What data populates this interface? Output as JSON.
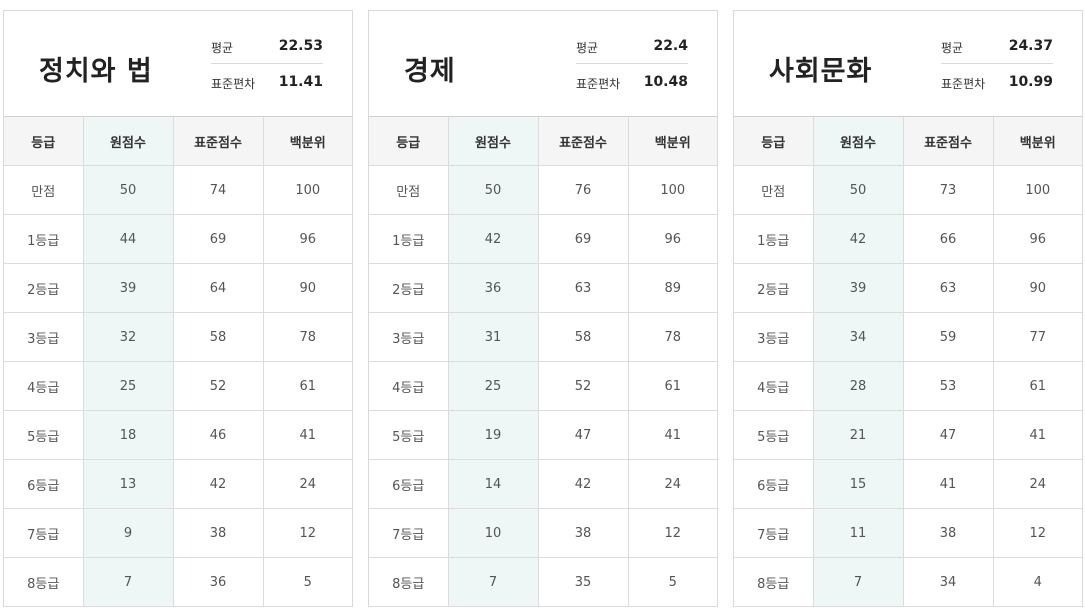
{
  "labels": {
    "mean": "평균",
    "std": "표준편차",
    "headers": [
      "등급",
      "원점수",
      "표준점수",
      "백분위"
    ]
  },
  "panels": [
    {
      "subject": "정치와 법",
      "mean": "22.53",
      "std": "11.41",
      "rows": [
        [
          "만점",
          "50",
          "74",
          "100"
        ],
        [
          "1등급",
          "44",
          "69",
          "96"
        ],
        [
          "2등급",
          "39",
          "64",
          "90"
        ],
        [
          "3등급",
          "32",
          "58",
          "78"
        ],
        [
          "4등급",
          "25",
          "52",
          "61"
        ],
        [
          "5등급",
          "18",
          "46",
          "41"
        ],
        [
          "6등급",
          "13",
          "42",
          "24"
        ],
        [
          "7등급",
          "9",
          "38",
          "12"
        ],
        [
          "8등급",
          "7",
          "36",
          "5"
        ]
      ]
    },
    {
      "subject": "경제",
      "mean": "22.4",
      "std": "10.48",
      "rows": [
        [
          "만점",
          "50",
          "76",
          "100"
        ],
        [
          "1등급",
          "42",
          "69",
          "96"
        ],
        [
          "2등급",
          "36",
          "63",
          "89"
        ],
        [
          "3등급",
          "31",
          "58",
          "78"
        ],
        [
          "4등급",
          "25",
          "52",
          "61"
        ],
        [
          "5등급",
          "19",
          "47",
          "41"
        ],
        [
          "6등급",
          "14",
          "42",
          "24"
        ],
        [
          "7등급",
          "10",
          "38",
          "12"
        ],
        [
          "8등급",
          "7",
          "35",
          "5"
        ]
      ]
    },
    {
      "subject": "사회문화",
      "mean": "24.37",
      "std": "10.99",
      "rows": [
        [
          "만점",
          "50",
          "73",
          "100"
        ],
        [
          "1등급",
          "42",
          "66",
          "96"
        ],
        [
          "2등급",
          "39",
          "63",
          "90"
        ],
        [
          "3등급",
          "34",
          "59",
          "77"
        ],
        [
          "4등급",
          "28",
          "53",
          "61"
        ],
        [
          "5등급",
          "21",
          "47",
          "41"
        ],
        [
          "6등급",
          "15",
          "41",
          "24"
        ],
        [
          "7등급",
          "11",
          "38",
          "12"
        ],
        [
          "8등급",
          "7",
          "34",
          "4"
        ]
      ]
    }
  ]
}
